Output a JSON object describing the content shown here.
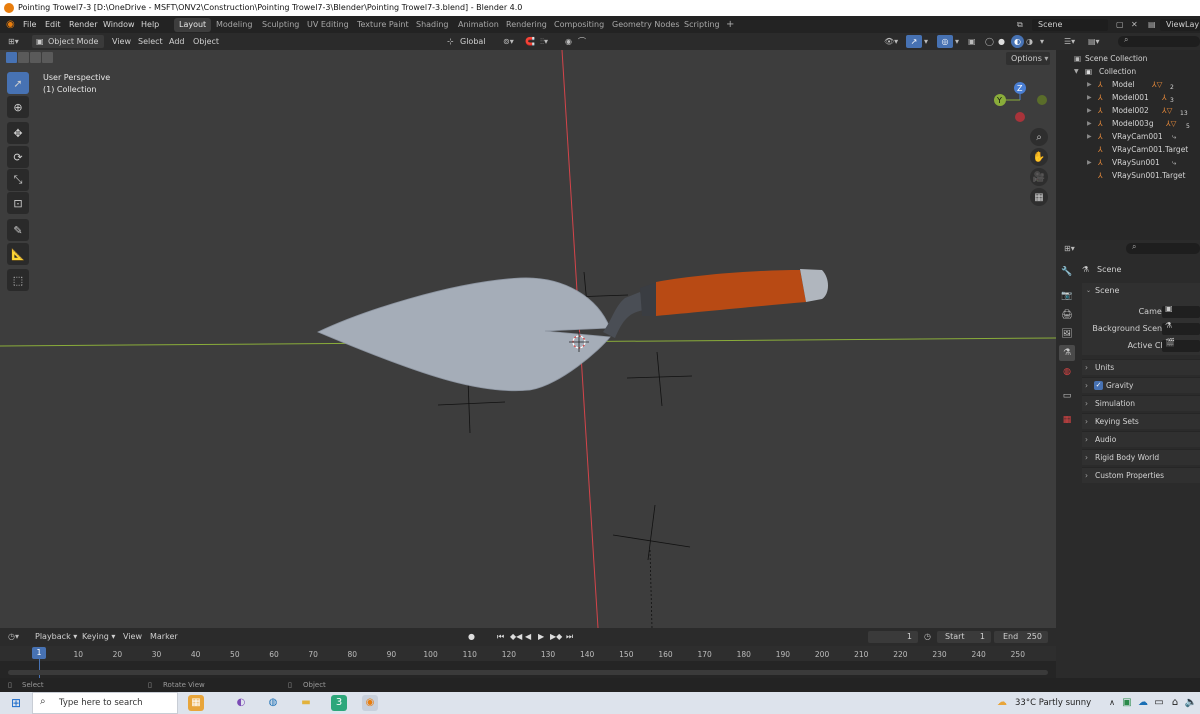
{
  "window": {
    "title": "Pointing Trowel7-3 [D:\\OneDrive - MSFT\\ONV2\\Construction\\Pointing Trowel7-3\\Blender\\Pointing Trowel7-3.blend] - Blender 4.0"
  },
  "menu": [
    "File",
    "Edit",
    "Render",
    "Window",
    "Help"
  ],
  "workspaces": [
    "Layout",
    "Modeling",
    "Sculpting",
    "UV Editing",
    "Texture Paint",
    "Shading",
    "Animation",
    "Rendering",
    "Compositing",
    "Geometry Nodes",
    "Scripting"
  ],
  "active_workspace": "Layout",
  "scene_selector": "Scene",
  "viewlayer_selector": "ViewLay",
  "viewport_header": {
    "mode": "Object Mode",
    "view": "View",
    "select": "Select",
    "add": "Add",
    "object": "Object",
    "orientation": "Global",
    "options": "Options"
  },
  "viewport_overlay": {
    "perspective": "User Perspective",
    "collection": "(1) Collection"
  },
  "gizmo": {
    "z": "Z",
    "y": "Y"
  },
  "outliner": {
    "root": "Scene Collection",
    "collection": "Collection",
    "items": [
      {
        "name": "Model",
        "badge": "2"
      },
      {
        "name": "Model001",
        "badge": "3"
      },
      {
        "name": "Model002",
        "badge": "13"
      },
      {
        "name": "Model003g",
        "badge": "5"
      },
      {
        "name": "VRayCam001",
        "badge": ""
      },
      {
        "name": "VRayCam001.Target",
        "badge": ""
      },
      {
        "name": "VRaySun001",
        "badge": ""
      },
      {
        "name": "VRaySun001.Target",
        "badge": ""
      }
    ]
  },
  "properties": {
    "context": "Scene",
    "panel": "Scene",
    "fields": [
      "Camera",
      "Background Scene",
      "Active Clip"
    ],
    "subpanels": [
      "Units",
      "Gravity",
      "Simulation",
      "Keying Sets",
      "Audio",
      "Rigid Body World",
      "Custom Properties"
    ]
  },
  "timeline": {
    "playback": "Playback",
    "keying": "Keying",
    "view": "View",
    "marker": "Marker",
    "current_frame": "1",
    "start_label": "Start",
    "start": "1",
    "end_label": "End",
    "end": "250",
    "ruler_marker": "1",
    "ticks": [
      "10",
      "20",
      "30",
      "40",
      "50",
      "60",
      "70",
      "80",
      "90",
      "100",
      "110",
      "120",
      "130",
      "140",
      "150",
      "160",
      "170",
      "180",
      "190",
      "200",
      "210",
      "220",
      "230",
      "240",
      "250"
    ]
  },
  "statusbar": {
    "select": "Select",
    "rotate": "Rotate View",
    "object": "Object"
  },
  "taskbar": {
    "search_placeholder": "Type here to search",
    "weather": "33°C  Partly sunny"
  },
  "colors": {
    "accent": "#4772b3",
    "viewport_bg": "#3d3d3d",
    "x_axis": "#d4444a",
    "y_axis": "#8aad3a",
    "handle": "#b84a14",
    "blade": "#a5adb8"
  }
}
